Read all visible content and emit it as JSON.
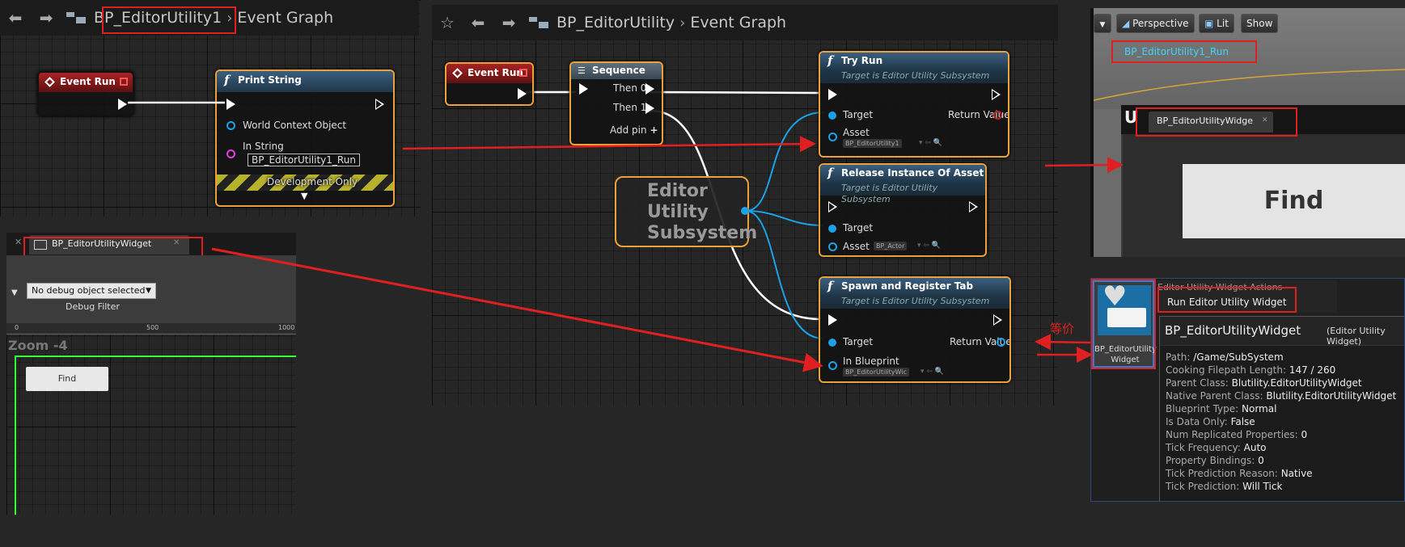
{
  "left_graph": {
    "tabs_title": "BP_EditorUtility1",
    "crumb_graph": "Event Graph",
    "event_node": {
      "title": "Event Run"
    },
    "print_node": {
      "title": "Print String",
      "pin_world": "World Context Object",
      "pin_string": "In String",
      "string_value": "BP_EditorUtility1_Run",
      "dev_only": "Development Only"
    }
  },
  "widget_panel": {
    "tab_label": "BP_EditorUtilityWidget",
    "debug_select": "No debug object selected",
    "debug_label": "Debug Filter",
    "ruler": [
      "0",
      "500",
      "1000"
    ],
    "zoom": "Zoom -4",
    "find_button": "Find"
  },
  "center_graph": {
    "crumb_bp": "BP_EditorUtility",
    "crumb_graph": "Event Graph",
    "event_node": {
      "title": "Event Run"
    },
    "sequence": {
      "title": "Sequence",
      "then0": "Then 0",
      "then1": "Then 1",
      "add_pin": "Add pin"
    },
    "subsystem_node": {
      "line1": "Editor",
      "line2": "Utility",
      "line3": "Subsystem"
    },
    "try_run": {
      "title": "Try Run",
      "subtitle": "Target is Editor Utility Subsystem",
      "target": "Target",
      "return": "Return Value",
      "asset": "Asset",
      "asset_value": "BP_EditorUtility1"
    },
    "release": {
      "title": "Release Instance Of Asset",
      "subtitle": "Target is Editor Utility Subsystem",
      "target": "Target",
      "asset": "Asset",
      "asset_value": "BP_Actor"
    },
    "spawn": {
      "title": "Spawn and Register Tab",
      "subtitle": "Target is Editor Utility Subsystem",
      "target": "Target",
      "return": "Return Value",
      "in_bp": "In Blueprint",
      "bp_value": "BP_EditorUtilityWic"
    }
  },
  "viewport": {
    "perspective": "Perspective",
    "lit": "Lit",
    "show": "Show",
    "print_output": "BP_EditorUtility1_Run",
    "widget_tab": "BP_EditorUtilityWidge",
    "find_button": "Find"
  },
  "asset_panel": {
    "annotation": "等价",
    "thumb_label1": "BP_EditorUtility",
    "thumb_label2": "Widget",
    "menu_header": "Editor Utility Widget Actions",
    "menu_item": "Run Editor Utility Widget",
    "tooltip": {
      "title": "BP_EditorUtilityWidget",
      "title_suffix": "(Editor Utility Widget)",
      "rows": [
        {
          "k": "Path:",
          "v": "/Game/SubSystem"
        },
        {
          "k": "Cooking Filepath Length:",
          "v": "147 / 260"
        },
        {
          "k": "Parent Class:",
          "v": "Blutility.EditorUtilityWidget"
        },
        {
          "k": "Native Parent Class:",
          "v": "Blutility.EditorUtilityWidget"
        },
        {
          "k": "Blueprint Type:",
          "v": "Normal"
        },
        {
          "k": "Is Data Only:",
          "v": "False"
        },
        {
          "k": "Num Replicated Properties:",
          "v": "0"
        },
        {
          "k": "Tick Frequency:",
          "v": "Auto"
        },
        {
          "k": "Property Bindings:",
          "v": "0"
        },
        {
          "k": "Tick Prediction Reason:",
          "v": "Native"
        },
        {
          "k": "Tick Prediction:",
          "v": "Will Tick"
        }
      ]
    }
  },
  "colors": {
    "node_border": "#e9a23b",
    "annotation_red": "#e02020",
    "pin_blue": "#1aa1e6"
  }
}
